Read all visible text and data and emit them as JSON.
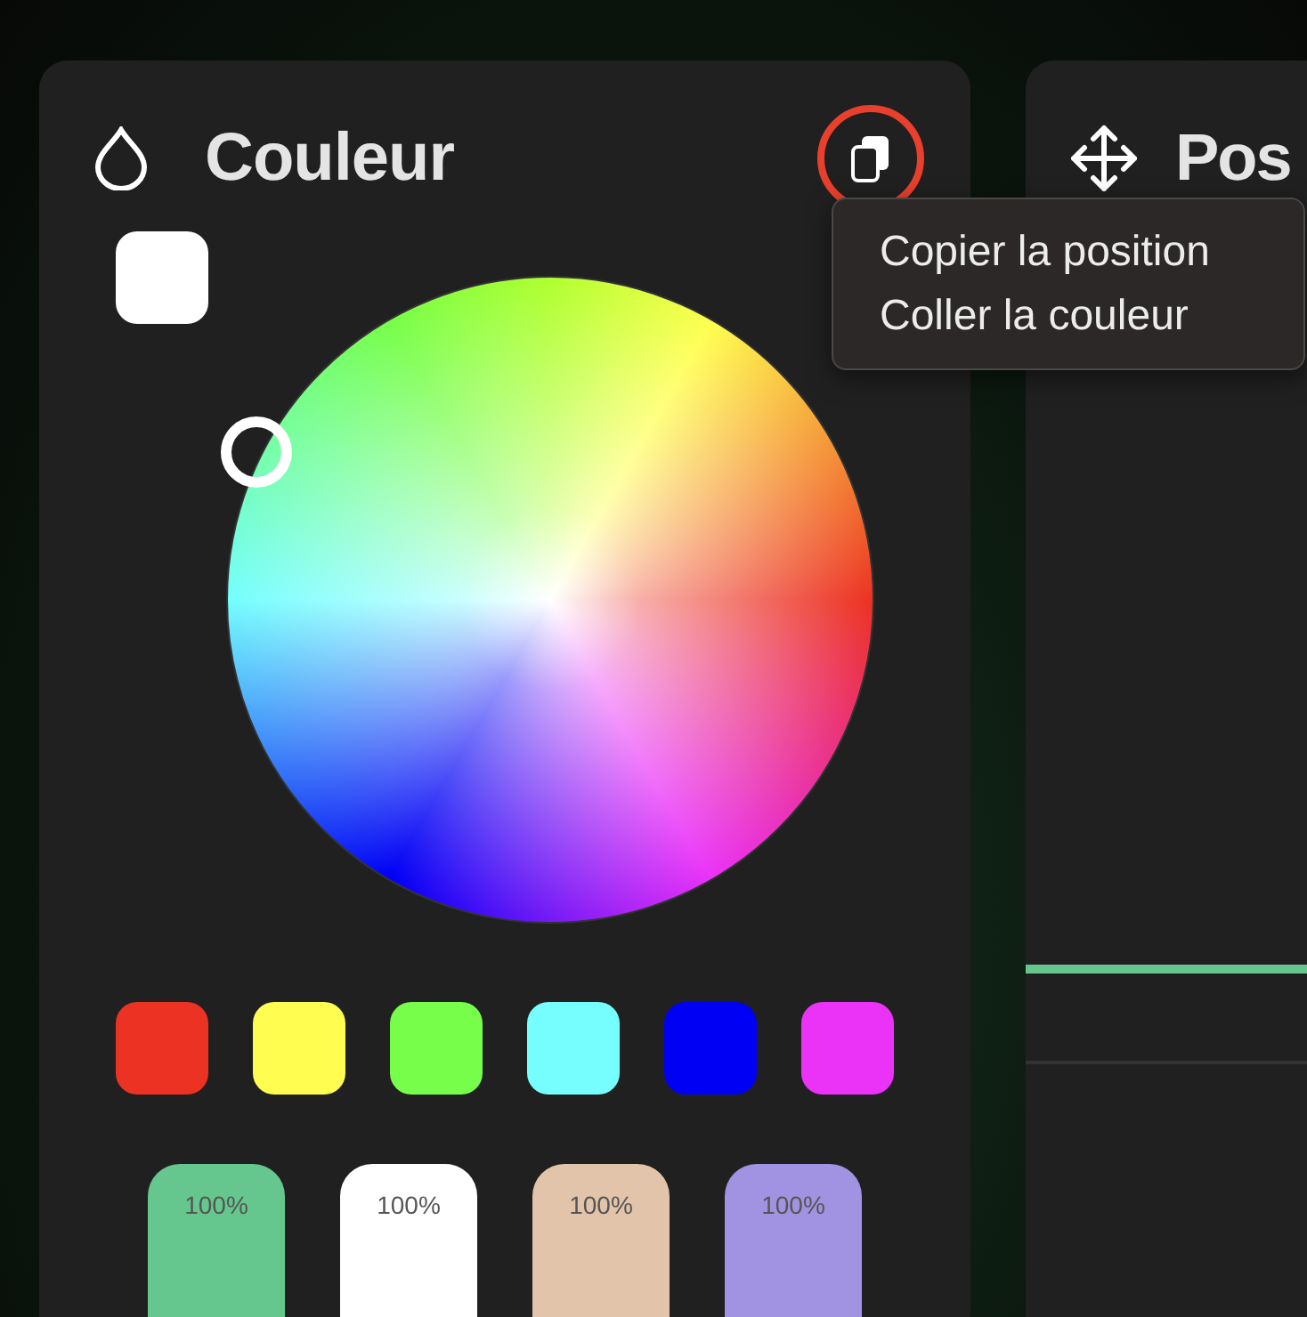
{
  "color_panel": {
    "title": "Couleur",
    "copy_button": {
      "highlighted": true
    },
    "swatches": [
      {
        "color": "#ec3323"
      },
      {
        "color": "#fffe50"
      },
      {
        "color": "#77fe4a"
      },
      {
        "color": "#76fefe"
      },
      {
        "color": "#0000f5"
      },
      {
        "color": "#ea33f7"
      }
    ],
    "presets": [
      {
        "label": "100%",
        "color": "#66c78e"
      },
      {
        "label": "100%",
        "color": "#ffffff"
      },
      {
        "label": "100%",
        "color": "#e2c4aa"
      },
      {
        "label": "100%",
        "color": "#a193e2"
      }
    ]
  },
  "context_menu": {
    "items": [
      {
        "label": "Copier la position"
      },
      {
        "label": "Coller la couleur"
      }
    ]
  },
  "position_panel": {
    "title": "Pos"
  }
}
